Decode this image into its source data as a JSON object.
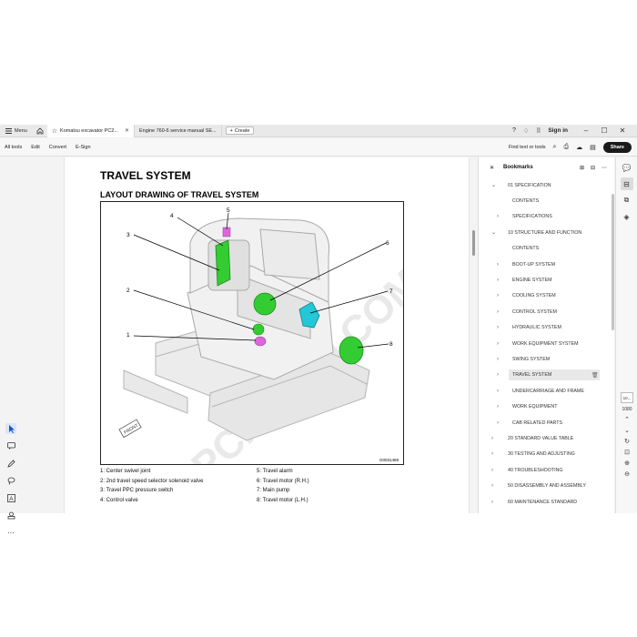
{
  "tabbar": {
    "menu_label": "Menu",
    "tabs": [
      {
        "label": "Komatsu excavator PC2..."
      },
      {
        "label": "Engine 760-6 service manual SE..."
      }
    ],
    "create_label": "Create",
    "signin_label": "Sign in"
  },
  "toolbar": {
    "menu": [
      "All tools",
      "Edit",
      "Convert",
      "E-Sign"
    ],
    "find_label": "Find text or tools",
    "share_label": "Share"
  },
  "document": {
    "title": "TRAVEL SYSTEM",
    "subtitle": "LAYOUT DRAWING OF TRAVEL SYSTEM",
    "figure_id": "G0031469",
    "callouts": [
      "1",
      "2",
      "3",
      "4",
      "5",
      "6",
      "7",
      "8"
    ],
    "legend_left": [
      "1: Center swivel joint",
      "2: 2nd travel speed selector solenoid valve",
      "3: Travel PPC pressure switch",
      "4: Control valve"
    ],
    "legend_right": [
      "5: Travel alarm",
      "6: Travel motor (R.H.)",
      "7: Main pump",
      "8: Travel motor (L.H.)"
    ],
    "front_label": "FRONT",
    "watermark": "EPCATALO.COM"
  },
  "bookmarks": {
    "title": "Bookmarks",
    "items": [
      {
        "label": "01 SPECIFICATION",
        "level": 0,
        "chev": "⌄"
      },
      {
        "label": "CONTENTS",
        "level": 1,
        "chev": ""
      },
      {
        "label": "SPECIFICATIONS",
        "level": 1,
        "chev": "›"
      },
      {
        "label": "10 STRUCTURE AND FUNCTION",
        "level": 0,
        "chev": "⌄"
      },
      {
        "label": "CONTENTS",
        "level": 1,
        "chev": ""
      },
      {
        "label": "BOOT-UP SYSTEM",
        "level": 1,
        "chev": "›"
      },
      {
        "label": "ENGINE SYSTEM",
        "level": 1,
        "chev": "›"
      },
      {
        "label": "COOLING SYSTEM",
        "level": 1,
        "chev": "›"
      },
      {
        "label": "CONTROL SYSTEM",
        "level": 1,
        "chev": "›"
      },
      {
        "label": "HYDRAULIC SYSTEM",
        "level": 1,
        "chev": "›"
      },
      {
        "label": "WORK EQUIPMENT SYSTEM",
        "level": 1,
        "chev": "›"
      },
      {
        "label": "SWING SYSTEM",
        "level": 1,
        "chev": "›"
      },
      {
        "label": "TRAVEL SYSTEM",
        "level": 1,
        "chev": "›",
        "selected": true
      },
      {
        "label": "UNDERCARRIAGE AND FRAME",
        "level": 1,
        "chev": "›"
      },
      {
        "label": "WORK EQUIPMENT",
        "level": 1,
        "chev": "›"
      },
      {
        "label": "CAB RELATED PARTS",
        "level": 1,
        "chev": "›"
      },
      {
        "label": "20 STANDARD VALUE TABLE",
        "level": 0,
        "chev": "›"
      },
      {
        "label": "30 TESTING AND ADJUSTING",
        "level": 0,
        "chev": "›"
      },
      {
        "label": "40 TROUBLESHOOTING",
        "level": 0,
        "chev": "›"
      },
      {
        "label": "50 DISASSEMBLY AND ASSEMBLY",
        "level": 0,
        "chev": "›"
      },
      {
        "label": "60 MAINTENANCE STANDARD",
        "level": 0,
        "chev": "›"
      }
    ]
  },
  "rail": {
    "page_current": "10...",
    "page_total": "1080"
  },
  "colors": {
    "green_part": "#33cc33",
    "cyan_part": "#22c8d8",
    "magenta_part": "#dd66dd",
    "share_bg": "#1a1a1a"
  }
}
